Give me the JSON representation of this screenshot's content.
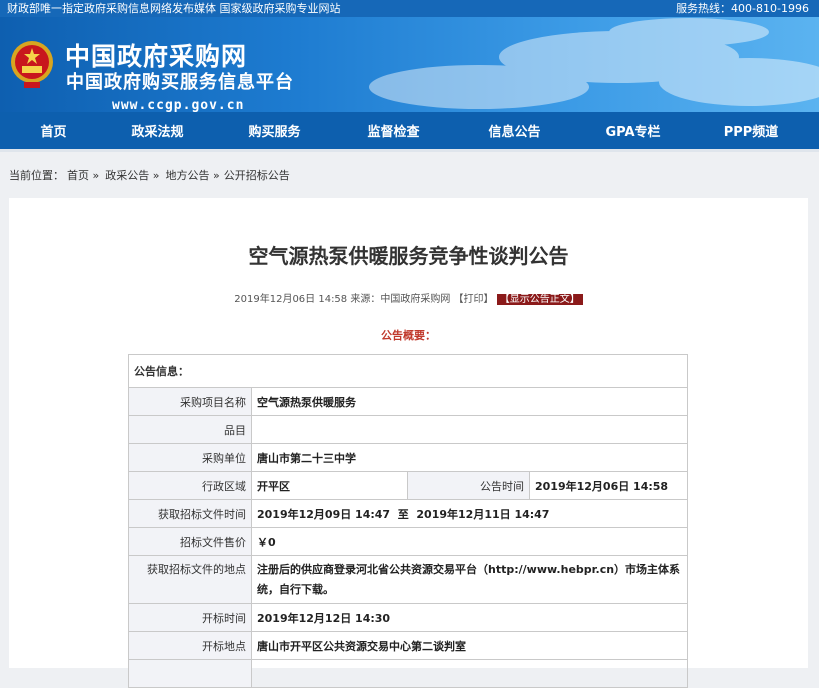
{
  "topbar": {
    "left": "财政部唯一指定政府采购信息网络发布媒体 国家级政府采购专业网站",
    "right": "服务热线：400-810-1996"
  },
  "header": {
    "title": "中国政府采购网",
    "subtitle": "中国政府购买服务信息平台",
    "url": "www.ccgp.gov.cn"
  },
  "nav": [
    "首页",
    "政采法规",
    "购买服务",
    "监督检查",
    "信息公告",
    "GPA专栏",
    "PPP频道"
  ],
  "breadcrumb": {
    "prefix": "当前位置：",
    "items": [
      "首页 »",
      "政采公告 »",
      "地方公告 »",
      "公开招标公告"
    ]
  },
  "article": {
    "title": "空气源热泵供暖服务竞争性谈判公告",
    "datetime": "2019年12月06日 14:58",
    "source": "来源：中国政府采购网",
    "print": "【打印】",
    "show_body": "【显示公告正文】",
    "summary_label": "公告概要："
  },
  "info": {
    "header": "公告信息：",
    "project_name_label": "采购项目名称",
    "project_name": "空气源热泵供暖服务",
    "item_label": "品目",
    "item": "",
    "unit_label": "采购单位",
    "unit": "唐山市第二十三中学",
    "region_label": "行政区域",
    "region": "开平区",
    "pubtime_label": "公告时间",
    "pubtime": "2019年12月06日 14:58",
    "doc_time_label": "获取招标文件时间",
    "doc_time": "2019年12月09日 14:47  至  2019年12月11日 14:47",
    "price_label": "招标文件售价",
    "price": "￥0",
    "doc_place_label": "获取招标文件的地点",
    "doc_place": "注册后的供应商登录河北省公共资源交易平台（http://www.hebpr.cn）市场主体系统，自行下载。",
    "open_time_label": "开标时间",
    "open_time": "2019年12月12日 14:30",
    "open_place_label": "开标地点",
    "open_place": "唐山市开平区公共资源交易中心第二谈判室"
  }
}
